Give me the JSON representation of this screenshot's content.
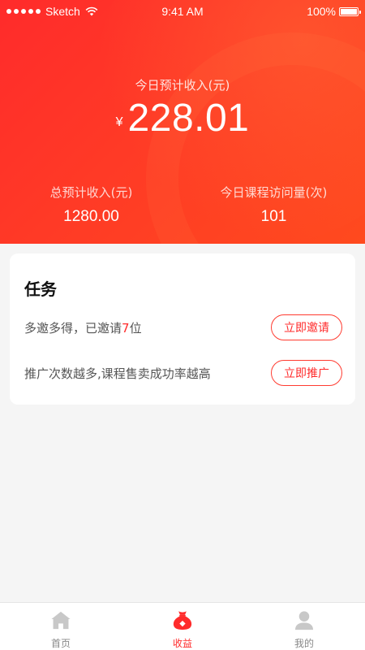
{
  "status_bar": {
    "carrier": "Sketch",
    "time": "9:41 AM",
    "battery": "100%"
  },
  "hero": {
    "today_label": "今日预计收入(元)",
    "currency": "¥",
    "today_amount": "228.01",
    "total_label": "总预计收入(元)",
    "total_value": "1280.00",
    "visits_label": "今日课程访问量(次)",
    "visits_value": "101"
  },
  "tasks": {
    "title": "任务",
    "items": [
      {
        "text_prefix": "多邀多得，已邀请",
        "count": "7",
        "text_suffix": "位",
        "button": "立即邀请"
      },
      {
        "text": "推广次数越多,课程售卖成功率越高",
        "button": "立即推广"
      }
    ]
  },
  "tabbar": {
    "items": [
      {
        "label": "首页",
        "icon": "home-icon"
      },
      {
        "label": "收益",
        "icon": "money-bag-icon",
        "active": true
      },
      {
        "label": "我的",
        "icon": "user-icon"
      }
    ]
  },
  "colors": {
    "accent": "#ff2b2b",
    "hero_start": "#ff2b2b",
    "hero_end": "#ff4a1e",
    "tab_inactive": "#888888",
    "icon_inactive": "#c8c8c8"
  }
}
